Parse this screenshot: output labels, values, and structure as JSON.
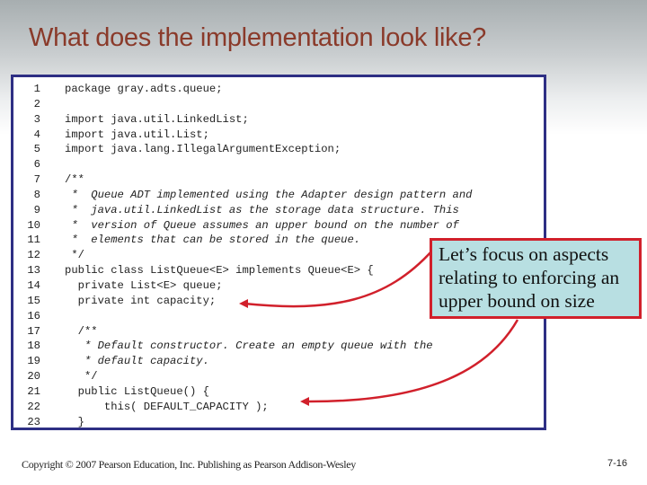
{
  "slide": {
    "title": "What does the implementation look like?",
    "code": [
      {
        "n": "1",
        "text": "package gray.adts.queue;",
        "italic": false
      },
      {
        "n": "2",
        "text": "",
        "italic": false
      },
      {
        "n": "3",
        "text": "import java.util.LinkedList;",
        "italic": false
      },
      {
        "n": "4",
        "text": "import java.util.List;",
        "italic": false
      },
      {
        "n": "5",
        "text": "import java.lang.IllegalArgumentException;",
        "italic": false
      },
      {
        "n": "6",
        "text": "",
        "italic": false
      },
      {
        "n": "7",
        "text": "/**",
        "italic": false
      },
      {
        "n": "8",
        "text": " *  Queue ADT implemented using the Adapter design pattern and",
        "italic": true
      },
      {
        "n": "9",
        "text": " *  java.util.LinkedList as the storage data structure. This",
        "italic": true
      },
      {
        "n": "10",
        "text": " *  version of Queue assumes an upper bound on the number of",
        "italic": true
      },
      {
        "n": "11",
        "text": " *  elements that can be stored in the queue.",
        "italic": true
      },
      {
        "n": "12",
        "text": " */",
        "italic": false
      },
      {
        "n": "13",
        "text": "public class ListQueue<E> implements Queue<E> {",
        "italic": false
      },
      {
        "n": "14",
        "text": "  private List<E> queue;",
        "italic": false
      },
      {
        "n": "15",
        "text": "  private int capacity;",
        "italic": false
      },
      {
        "n": "16",
        "text": "",
        "italic": false
      },
      {
        "n": "17",
        "text": "  /**",
        "italic": false
      },
      {
        "n": "18",
        "text": "   * Default constructor. Create an empty queue with the",
        "italic": true
      },
      {
        "n": "19",
        "text": "   * default capacity.",
        "italic": true
      },
      {
        "n": "20",
        "text": "   */",
        "italic": false
      },
      {
        "n": "21",
        "text": "  public ListQueue() {",
        "italic": false
      },
      {
        "n": "22",
        "text": "      this( DEFAULT_CAPACITY );",
        "italic": false
      },
      {
        "n": "23",
        "text": "  }",
        "italic": false
      }
    ],
    "callout": {
      "text": "Let’s focus on aspects relating to enforcing an upper bound on size",
      "lines": [
        "Let’s focus on aspects",
        "relating to enforcing an",
        "upper bound on size"
      ]
    },
    "footer": {
      "copyright": "Copyright © 2007 Pearson Education, Inc. Publishing as Pearson Addison-Wesley",
      "page": "7-16"
    },
    "colors": {
      "title": "#8a3a2a",
      "frame_border": "#2e2f84",
      "callout_bg": "#b8dfe2",
      "callout_border": "#d1202b",
      "arrow": "#d1202b"
    }
  }
}
